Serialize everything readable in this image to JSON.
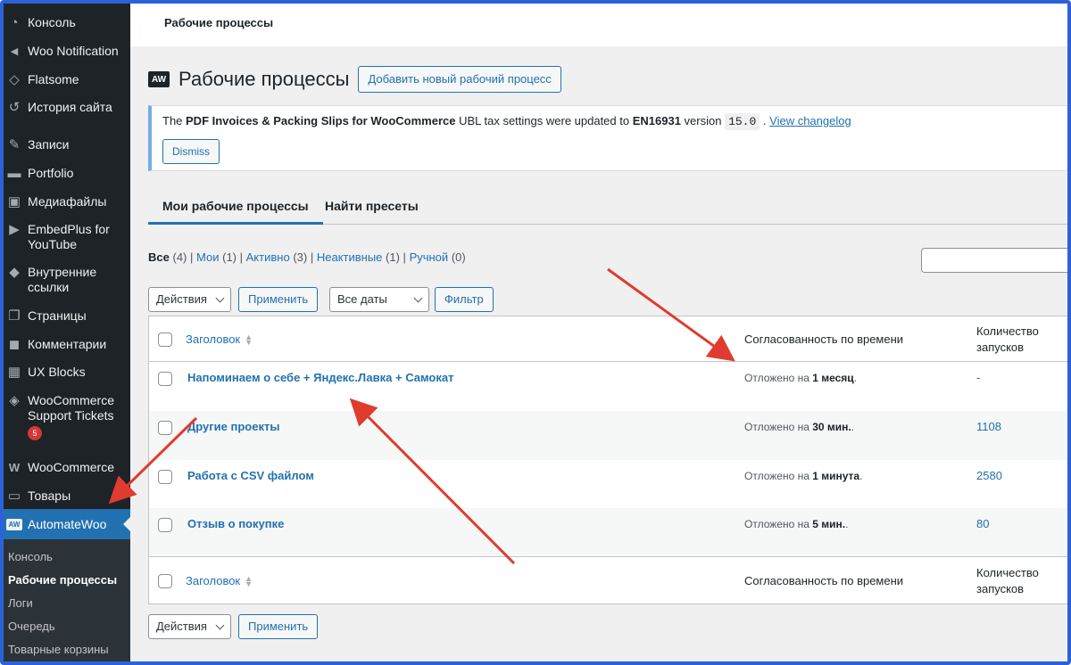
{
  "sidebar": {
    "items": [
      {
        "label": "Консоль",
        "icon": "dashboard-icon",
        "glyph": "◔"
      },
      {
        "label": "Woo Notification",
        "icon": "megaphone-icon",
        "glyph": "📣"
      },
      {
        "label": "Flatsome",
        "icon": "diamond-icon",
        "glyph": "◇"
      },
      {
        "label": "История сайта",
        "icon": "history-icon",
        "glyph": "↺"
      },
      {
        "label": "Записи",
        "icon": "pin-icon",
        "glyph": "✎"
      },
      {
        "label": "Portfolio",
        "icon": "folder-icon",
        "glyph": "▬"
      },
      {
        "label": "Медиафайлы",
        "icon": "media-icon",
        "glyph": "▣"
      },
      {
        "label": "EmbedPlus for YouTube",
        "icon": "video-icon",
        "glyph": "▶"
      },
      {
        "label": "Внутренние ссылки",
        "icon": "drop-icon",
        "glyph": "◆"
      },
      {
        "label": "Страницы",
        "icon": "pages-icon",
        "glyph": "❐"
      },
      {
        "label": "Комментарии",
        "icon": "comment-icon",
        "glyph": "◼"
      },
      {
        "label": "UX Blocks",
        "icon": "grid-icon",
        "glyph": "▦"
      },
      {
        "label": "WooCommerce Support Tickets",
        "icon": "support-icon",
        "glyph": "◈",
        "badge": "5"
      },
      {
        "label": "WooCommerce",
        "icon": "woocommerce-icon",
        "glyph": "W"
      },
      {
        "label": "Товары",
        "icon": "archive-icon",
        "glyph": "▭"
      },
      {
        "label": "AutomateWoo",
        "icon": "automatewoo-icon",
        "glyph": "AW"
      }
    ],
    "submenu": [
      "Консоль",
      "Рабочие процессы",
      "Логи",
      "Очередь",
      "Товарные корзины"
    ]
  },
  "topbar": {
    "title": "Рабочие процессы"
  },
  "header": {
    "logo": "AW",
    "title": "Рабочие процессы",
    "add_button": "Добавить новый рабочий процесс"
  },
  "notice": {
    "pre": "The ",
    "plugin": "PDF Invoices & Packing Slips for WooCommerce",
    "mid": " UBL tax settings were updated to ",
    "standard": "EN16931",
    "version_label": " version ",
    "version": "15.0",
    "sep": " . ",
    "link": "View changelog",
    "dismiss": "Dismiss"
  },
  "tabs": [
    "Мои рабочие процессы",
    "Найти пресеты"
  ],
  "filters": {
    "views": [
      {
        "label": "Все",
        "count": "(4)"
      },
      {
        "label": "Мои",
        "count": "(1)"
      },
      {
        "label": "Активно",
        "count": "(3)"
      },
      {
        "label": "Неактивные",
        "count": "(1)"
      },
      {
        "label": "Ручной",
        "count": "(0)"
      }
    ],
    "separator": "|",
    "bulk_action": "Действия",
    "apply": "Применить",
    "dates": "Все даты",
    "filter_button": "Фильтр"
  },
  "table": {
    "columns": {
      "title": "Заголовок",
      "timing": "Согласованность по времени",
      "runs": "Количество запусков"
    },
    "rows": [
      {
        "title": "Напоминаем о себе + Яндекс.Лавка + Самокат",
        "timing_prefix": "Отложено на ",
        "timing_value": "1 месяц",
        "timing_suffix": ".",
        "runs": "-"
      },
      {
        "title": "Другие проекты",
        "timing_prefix": "Отложено на ",
        "timing_value": "30 мин.",
        "timing_suffix": ".",
        "runs": "1108"
      },
      {
        "title": "Работа с CSV файлом",
        "timing_prefix": "Отложено на ",
        "timing_value": "1 минута",
        "timing_suffix": ".",
        "runs": "2580"
      },
      {
        "title": "Отзыв о покупке",
        "timing_prefix": "Отложено на ",
        "timing_value": "5 мин.",
        "timing_suffix": ".",
        "runs": "80"
      }
    ]
  },
  "colors": {
    "accent": "#2271b1",
    "sidebar": "#1d2327",
    "arrow": "#e03b2f",
    "frame": "#2b62d9"
  }
}
